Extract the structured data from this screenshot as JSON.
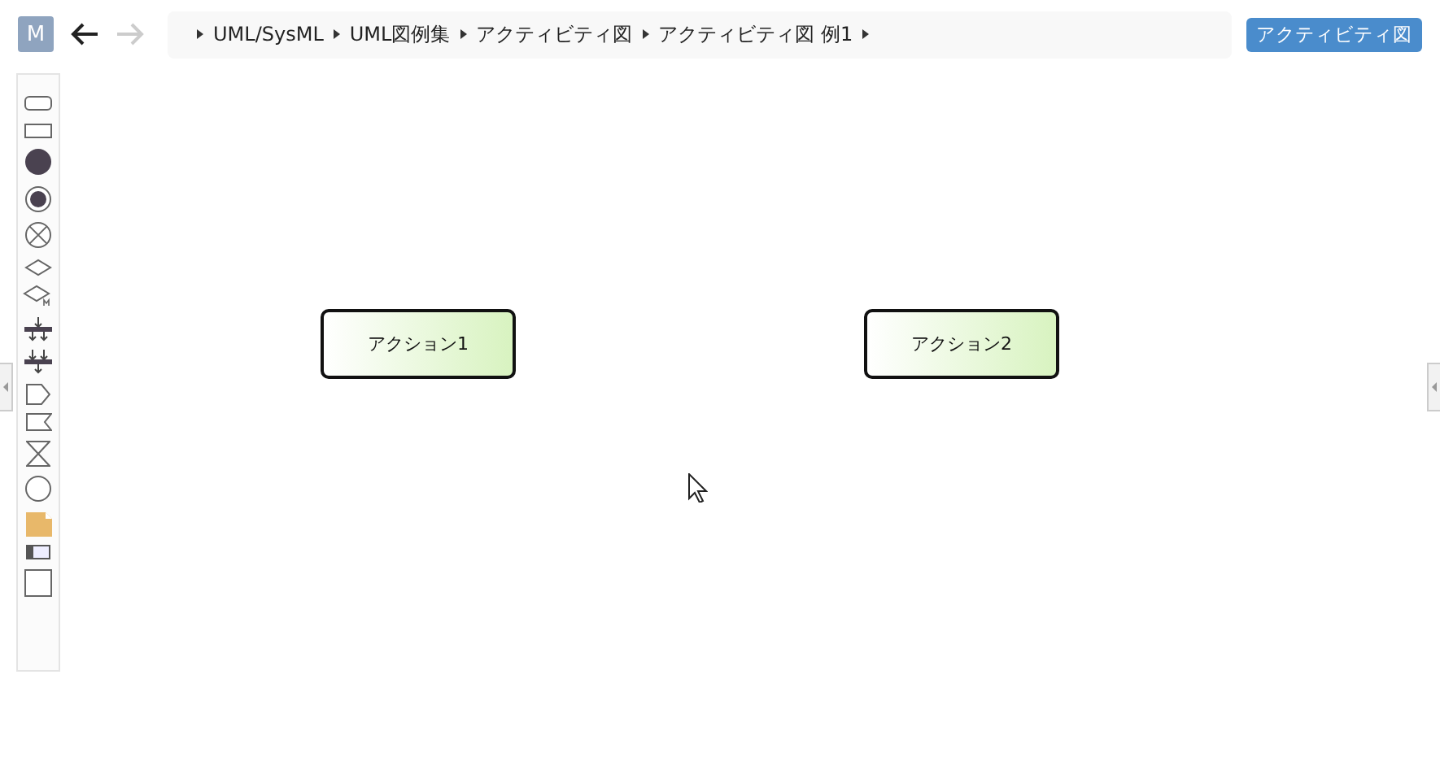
{
  "avatar": {
    "letter": "M"
  },
  "nav": {
    "back_disabled": false,
    "forward_disabled": true
  },
  "breadcrumbs": [
    "UML/SysML",
    "UML図例集",
    "アクティビティ図",
    "アクティビティ図 例1"
  ],
  "diagram_type_button": "アクティビティ図",
  "toolbar": [
    {
      "kind": "rounded-rect"
    },
    {
      "kind": "rect"
    },
    {
      "kind": "initial"
    },
    {
      "kind": "final"
    },
    {
      "kind": "flow-final"
    },
    {
      "kind": "decision"
    },
    {
      "kind": "merge"
    },
    {
      "kind": "fork"
    },
    {
      "kind": "join"
    },
    {
      "kind": "send"
    },
    {
      "kind": "accept"
    },
    {
      "kind": "time"
    },
    {
      "kind": "circle"
    },
    {
      "kind": "note"
    },
    {
      "kind": "partition"
    },
    {
      "kind": "frame"
    }
  ],
  "canvas": {
    "actions": [
      {
        "label": "アクション1"
      },
      {
        "label": "アクション2"
      }
    ]
  }
}
